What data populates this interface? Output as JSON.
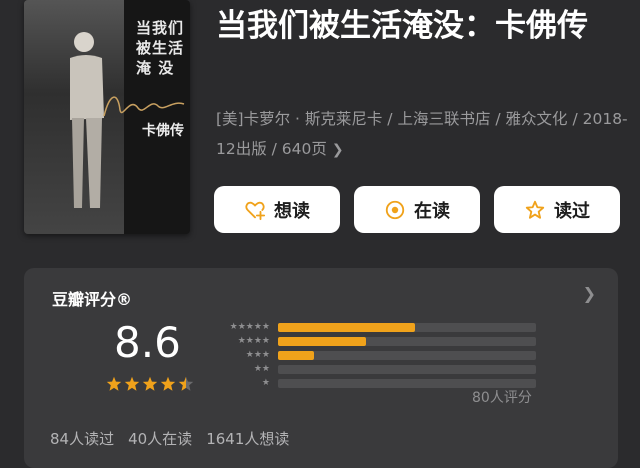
{
  "book": {
    "title": "当我们被生活淹没：卡佛传",
    "meta": "[美]卡萝尔 · 斯克莱尼卡 / 上海三联书店 / 雅众文化 / 2018-12出版 / 640页",
    "cover": {
      "title_lines": [
        "当我们",
        "被生活",
        "淹 没"
      ],
      "subtitle": "卡佛传"
    }
  },
  "actions": {
    "want_label": "想读",
    "reading_label": "在读",
    "read_label": "读过"
  },
  "rating": {
    "title": "豆瓣评分®",
    "score": "8.6",
    "star_level": 4.5,
    "distribution_fraction": [
      0.53,
      0.34,
      0.14,
      0.0,
      0.0
    ],
    "count_label": "80人评分",
    "accent_color": "#f0a21b"
  },
  "stats": {
    "read": "84人读过",
    "reading": "40人在读",
    "want": "1641人想读"
  }
}
